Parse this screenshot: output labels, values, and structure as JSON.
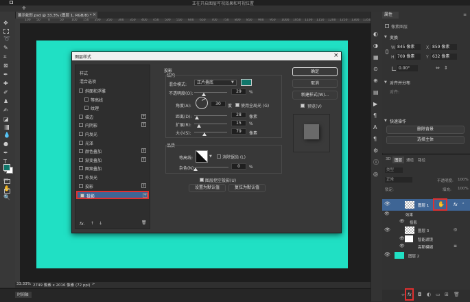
{
  "menubar": {
    "title": "正在开启图层可视效果和可视位置"
  },
  "tab": {
    "label": "展示蛇形.psd @ 33.3% (图层 1, RGB/8) *",
    "close": "×"
  },
  "ruler": {
    "ticks": [
      "100",
      "50",
      "0",
      "50",
      "100",
      "150",
      "200",
      "250",
      "300",
      "350",
      "400",
      "450",
      "500",
      "550",
      "600",
      "650",
      "700",
      "750",
      "800",
      "850",
      "900",
      "950",
      "1000",
      "1050",
      "1100",
      "1150",
      "1200",
      "1250",
      "1300",
      "1350",
      "1400"
    ]
  },
  "status": {
    "zoom": "33.33%",
    "info": "2749 像素 x 2016 像素 (72 ppi)",
    "arrow": ">",
    "timeline": "时间轴"
  },
  "dialog": {
    "title": "图层样式",
    "close": "×",
    "left": {
      "styles_label": "样式",
      "blend_label": "混合选项",
      "items": [
        {
          "label": "斜面和浮雕",
          "checked": false,
          "plus": false,
          "indent": false
        },
        {
          "label": "等高线",
          "checked": false,
          "plus": false,
          "indent": true
        },
        {
          "label": "纹理",
          "checked": false,
          "plus": false,
          "indent": true
        },
        {
          "label": "描边",
          "checked": false,
          "plus": true,
          "indent": false
        },
        {
          "label": "内阴影",
          "checked": false,
          "plus": true,
          "indent": false
        },
        {
          "label": "内发光",
          "checked": false,
          "plus": false,
          "indent": false
        },
        {
          "label": "光泽",
          "checked": false,
          "plus": false,
          "indent": false
        },
        {
          "label": "颜色叠加",
          "checked": false,
          "plus": true,
          "indent": false
        },
        {
          "label": "渐变叠加",
          "checked": false,
          "plus": true,
          "indent": false
        },
        {
          "label": "图案叠加",
          "checked": false,
          "plus": false,
          "indent": false
        },
        {
          "label": "外发光",
          "checked": false,
          "plus": false,
          "indent": false
        },
        {
          "label": "投影",
          "checked": false,
          "plus": true,
          "indent": false
        }
      ],
      "selected": {
        "label": "投影",
        "checked": true,
        "plus": true
      },
      "fx": "fx.",
      "up": "↑",
      "down": "↓",
      "trash": "🗑"
    },
    "drop_shadow": {
      "section_title": "投影",
      "structure_title": "结构",
      "blend_mode_label": "混合模式:",
      "blend_mode_value": "正片叠底",
      "color": "#0f766a",
      "opacity_label": "不透明度(O):",
      "opacity_value": "29",
      "opacity_level": 0.29,
      "angle_label": "角度(A):",
      "angle_value": "30",
      "degree": "度",
      "global_light_label": "使用全局光 (G)",
      "distance_label": "距离(D):",
      "distance_value": "28",
      "distance_level": 0.09,
      "spread_label": "扩展(R):",
      "spread_value": "15",
      "spread_level": 0.15,
      "size_label": "大小(S):",
      "size_value": "79",
      "size_level": 0.32,
      "unit_pixel": "像素",
      "unit_percent": "%",
      "quality_title": "品质",
      "contour_label": "等高线:",
      "antialias_label": "消除锯齿 (L)",
      "noise_label": "杂色(N):",
      "noise_value": "0",
      "noise_level": 0,
      "knockout_label": "图层挖空投影(U)",
      "set_default": "设置为默认值",
      "reset_default": "复位为默认值"
    },
    "buttons": {
      "ok": "确定",
      "cancel": "取消",
      "new_style": "新建样式(W)...",
      "preview": "预览(V)"
    }
  },
  "properties": {
    "title": "属性",
    "menu": "≡",
    "pixel_layer": "像素图层",
    "transform_title": "变换",
    "w_label": "W",
    "w_value": "845 像素",
    "x_label": "X",
    "x_value": "859 像素",
    "h_label": "H",
    "h_value": "709 像素",
    "y_label": "Y",
    "y_value": "632 像素",
    "angle_value": "0.00°",
    "align_title": "对齐并分布",
    "align_sub": "对齐:",
    "quick_title": "快速操作",
    "remove_bg": "删除背景",
    "select_subject": "选择主体"
  },
  "layers": {
    "tabs": [
      "3D",
      "图层",
      "通道",
      "路径"
    ],
    "kind_label": "类型",
    "blend_mode": "正常",
    "opacity_label": "不透明度:",
    "opacity_value": "100%",
    "lock_label": "锁定:",
    "fill_label": "填充:",
    "fill_value": "100%",
    "rows": [
      {
        "name": "图层 1",
        "fx": "fx",
        "selected": true
      },
      {
        "name": "效果",
        "sub": true
      },
      {
        "name": "投影",
        "sub": true
      },
      {
        "name": "图层 3"
      },
      {
        "name": "智能滤镜",
        "sub": true
      },
      {
        "name": "高斯模糊",
        "sub": true
      },
      {
        "name": "图层 2"
      }
    ]
  },
  "colors": {
    "canvas": "#20e0c4",
    "dark": "#2b2b2b",
    "highlight": "#e03030",
    "selection": "#3e6595"
  }
}
